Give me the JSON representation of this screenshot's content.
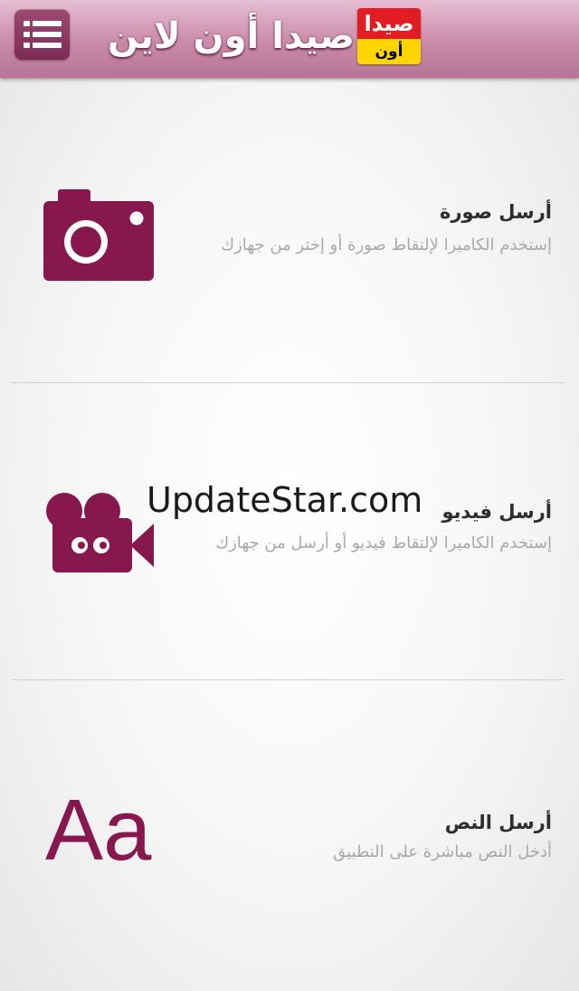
{
  "header": {
    "title": "صيدا أون لاين",
    "logo_top": "صيدا",
    "logo_bottom": "أون لاين",
    "menu_icon": "menu-list-icon"
  },
  "items": [
    {
      "title": "أرسل صورة",
      "description": "إستخدم الكاميرا لإلتقاط صورة أو إختر من جهازك",
      "icon": "camera-icon"
    },
    {
      "title": "أرسل فيديو",
      "description": "إستخدم الكاميرا لإلتقاط فيديو أو أرسل من جهازك",
      "icon": "video-camera-icon"
    },
    {
      "title": "أرسل النص",
      "description": "أدخل النص مباشرة على التطبيق",
      "icon": "text-icon",
      "icon_text": "Aa"
    }
  ],
  "watermark": "UpdateStar.com",
  "colors": {
    "accent": "#87184e",
    "header": "#c98aa9",
    "logo_red": "#e31c24",
    "logo_yellow": "#ffd500"
  }
}
